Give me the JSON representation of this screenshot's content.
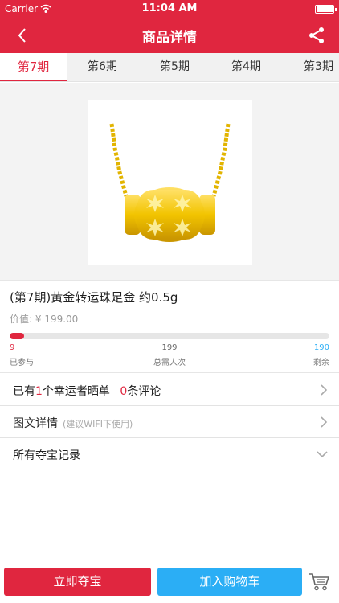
{
  "status_bar": {
    "carrier": "Carrier",
    "time": "11:04 AM"
  },
  "nav": {
    "title": "商品详情"
  },
  "tabs": [
    {
      "label": "第7期"
    },
    {
      "label": "第6期"
    },
    {
      "label": "第5期"
    },
    {
      "label": "第4期"
    },
    {
      "label": "第3期"
    }
  ],
  "product": {
    "title": "(第7期)黄金转运珠足金 约0.5g",
    "price_label": "价值:",
    "price": "¥ 199.00",
    "participated": "9",
    "total": "199",
    "remaining": "190",
    "participated_label": "已参与",
    "total_label": "总需人次",
    "remaining_label": "剩余",
    "progress_fraction": 0.045
  },
  "rows": {
    "reviews_prefix": "已有",
    "winners_count": "1",
    "reviews_mid": "个幸运者晒单",
    "comments_count": "0",
    "reviews_suffix": "条评论",
    "detail_label": "图文详情",
    "detail_hint": "(建议WIFI下使用)",
    "records_label": "所有夺宝记录"
  },
  "bottom": {
    "buy_label": "立即夺宝",
    "cart_label": "加入购物车"
  },
  "colors": {
    "brand_red": "#e0263f",
    "cart_blue": "#2baef5",
    "gold": "#f2c400"
  },
  "icons": [
    "wifi-icon",
    "battery-icon",
    "back-icon",
    "share-icon",
    "chevron-right-icon",
    "chevron-down-icon",
    "cart-icon"
  ]
}
